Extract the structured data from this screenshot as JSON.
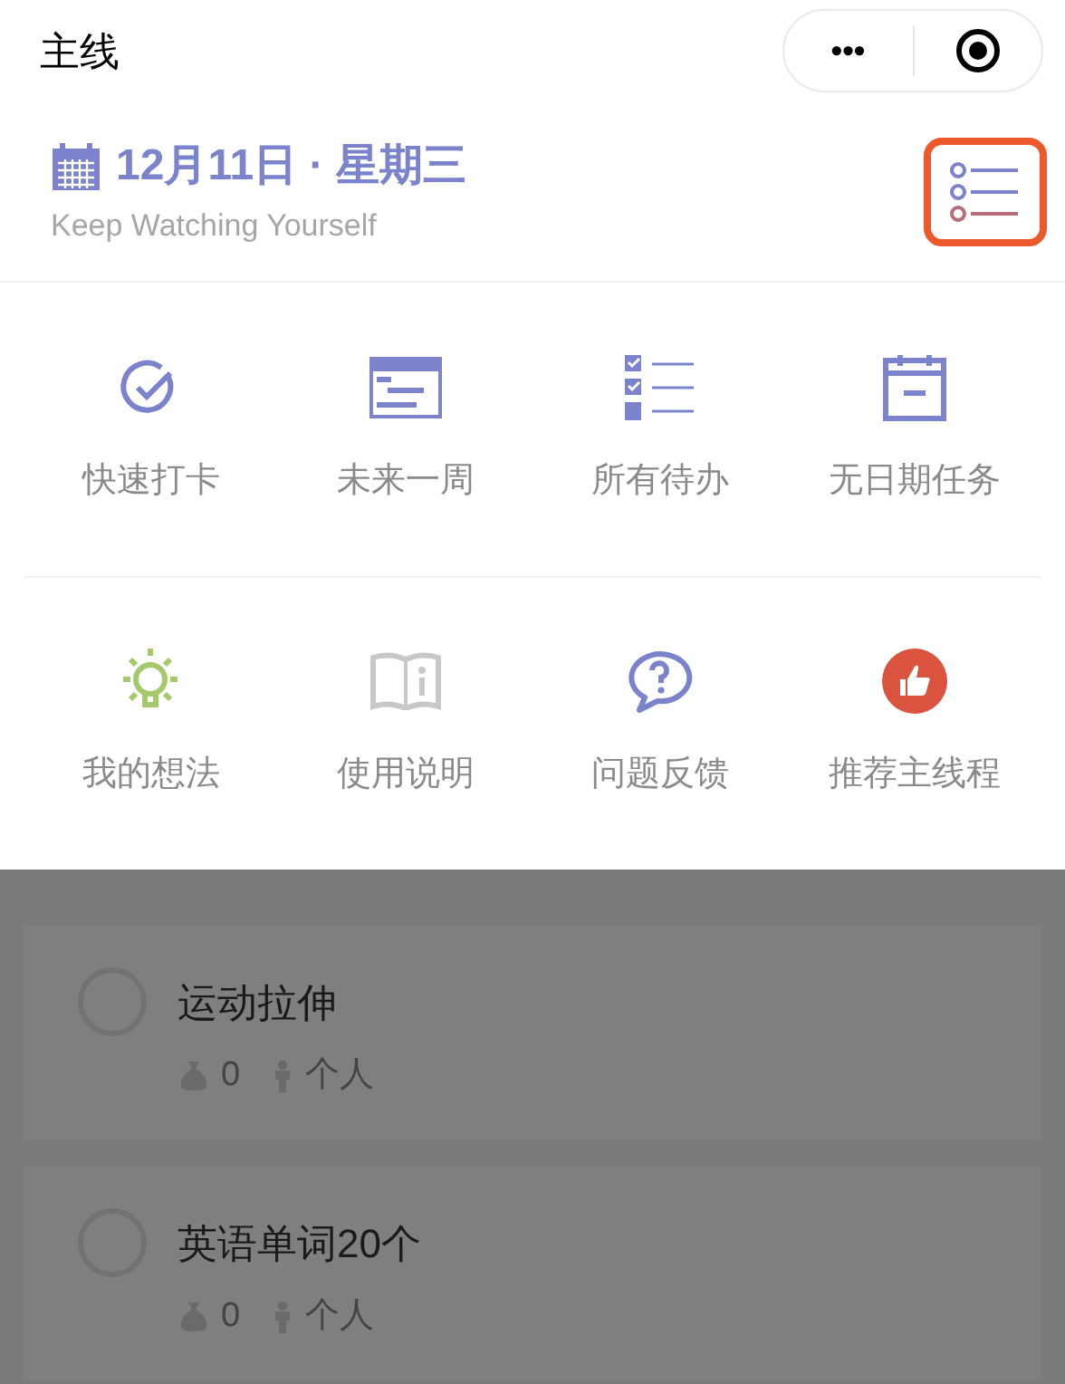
{
  "nav_bar": {
    "title": "主线",
    "more_button": "•••"
  },
  "date_header": {
    "date": "12月11日 · 星期三",
    "subtitle": "Keep Watching Yourself",
    "list_button": {
      "highlighted": true
    }
  },
  "menu_rows": [
    [
      {
        "label": "快速打卡",
        "kind": "check"
      },
      {
        "label": "未来一周",
        "kind": "week"
      },
      {
        "label": "所有待办",
        "kind": "todo"
      },
      {
        "label": "无日期任务",
        "kind": "nodate"
      }
    ],
    [
      {
        "label": "我的想法",
        "kind": "idea"
      },
      {
        "label": "使用说明",
        "kind": "manual"
      },
      {
        "label": "问题反馈",
        "kind": "feedback"
      },
      {
        "label": "推荐主线程",
        "kind": "recommend"
      }
    ]
  ],
  "tasks": [
    {
      "title": "运动拉伸",
      "checked": false,
      "coins": "0",
      "scope": "个人"
    },
    {
      "title": "英语单词20个",
      "checked": false,
      "coins": "0",
      "scope": "个人"
    }
  ]
}
